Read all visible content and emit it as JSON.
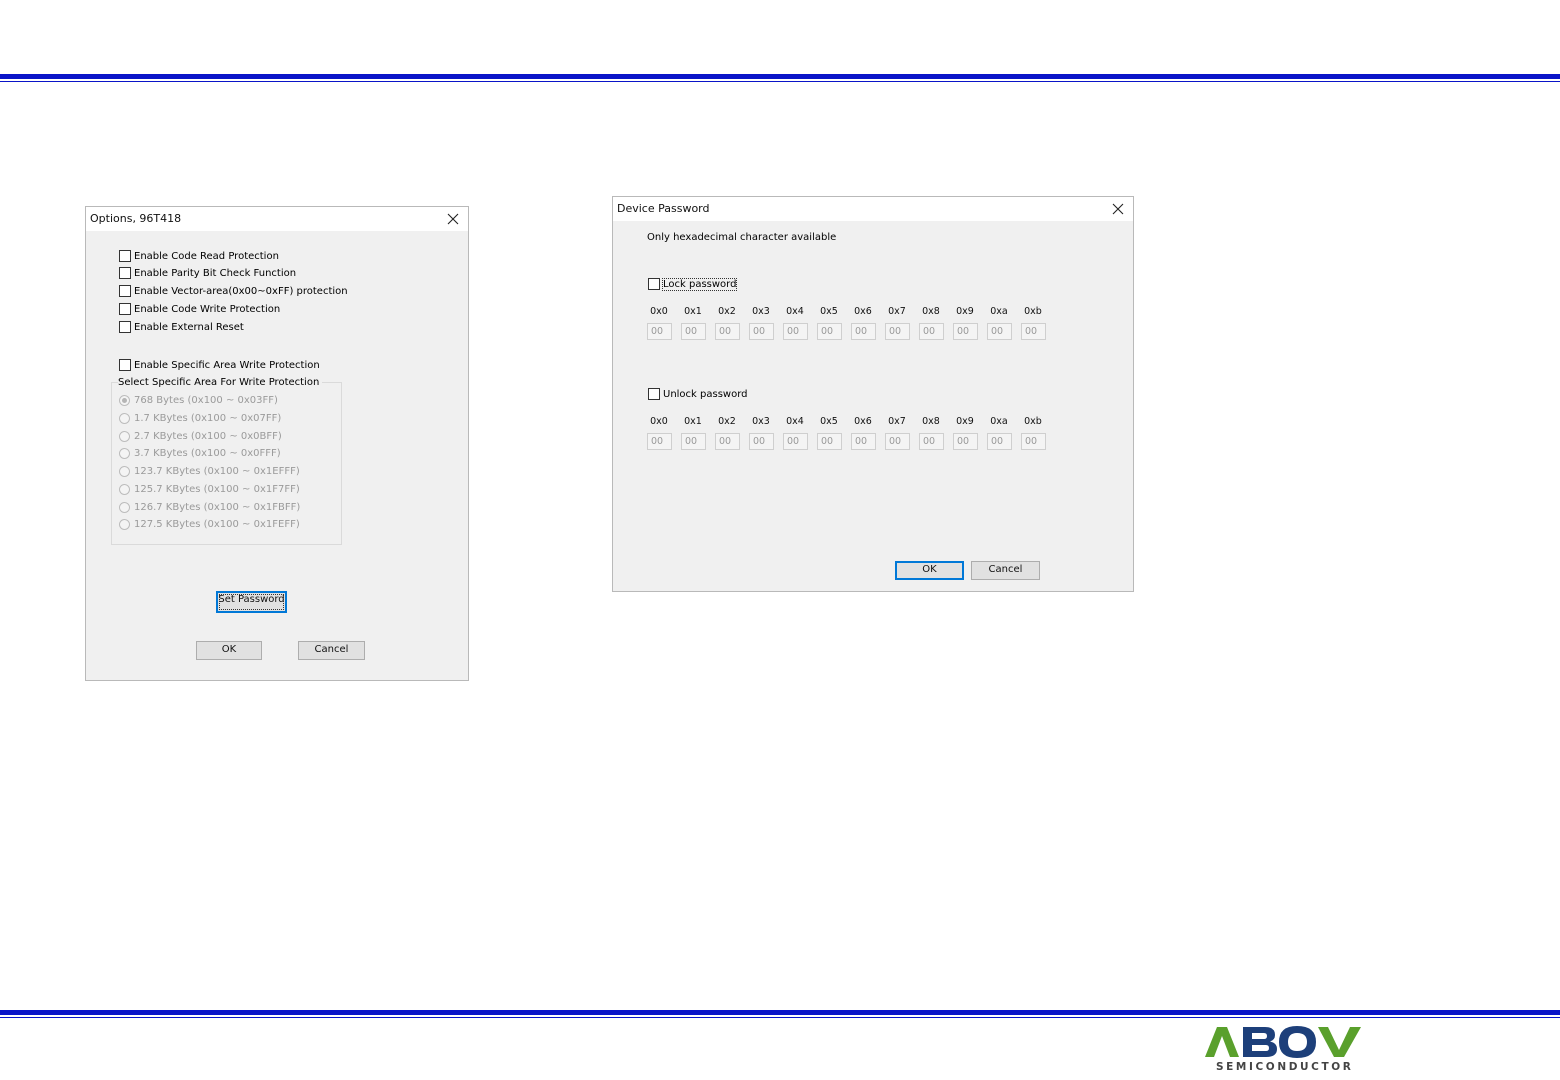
{
  "options_dialog": {
    "title": "Options, 96T418",
    "checkboxes": [
      "Enable Code Read Protection",
      "Enable Parity Bit Check Function",
      "Enable Vector-area(0x00~0xFF) protection",
      "Enable Code Write Protection",
      "Enable External Reset"
    ],
    "specific_area_checkbox": "Enable Specific Area Write Protection",
    "group_label": "Select Specific Area For Write Protection",
    "radios": [
      "768 Bytes (0x100 ~ 0x03FF)",
      "1.7 KBytes (0x100 ~ 0x07FF)",
      "2.7 KBytes (0x100 ~ 0x0BFF)",
      "3.7 KBytes (0x100 ~ 0x0FFF)",
      "123.7 KBytes (0x100 ~ 0x1EFFF)",
      "125.7 KBytes (0x100 ~ 0x1F7FF)",
      "126.7 KBytes (0x100 ~ 0x1FBFF)",
      "127.5 KBytes (0x100 ~ 0x1FEFF)"
    ],
    "selected_radio": "768 Bytes (0x100 ~ 0x03FF)",
    "set_password_label": "Set Password",
    "ok_label": "OK",
    "cancel_label": "Cancel"
  },
  "password_dialog": {
    "title": "Device Password",
    "hint": "Only hexadecimal character available",
    "lock_label": "Lock password",
    "unlock_label": "Unlock password",
    "byte_labels": [
      "0x0",
      "0x1",
      "0x2",
      "0x3",
      "0x4",
      "0x5",
      "0x6",
      "0x7",
      "0x8",
      "0x9",
      "0xa",
      "0xb"
    ],
    "lock_values": [
      "00",
      "00",
      "00",
      "00",
      "00",
      "00",
      "00",
      "00",
      "00",
      "00",
      "00",
      "00"
    ],
    "unlock_values": [
      "00",
      "00",
      "00",
      "00",
      "00",
      "00",
      "00",
      "00",
      "00",
      "00",
      "00",
      "00"
    ],
    "ok_label": "OK",
    "cancel_label": "Cancel"
  },
  "logo": {
    "brand": "ABOV",
    "tagline": "SEMICONDUCTOR"
  },
  "colors": {
    "rule_blue": "#0a14c8",
    "logo_green": "#5aa02c",
    "logo_navy": "#1d3f7a",
    "focus_blue": "#0078d7"
  }
}
